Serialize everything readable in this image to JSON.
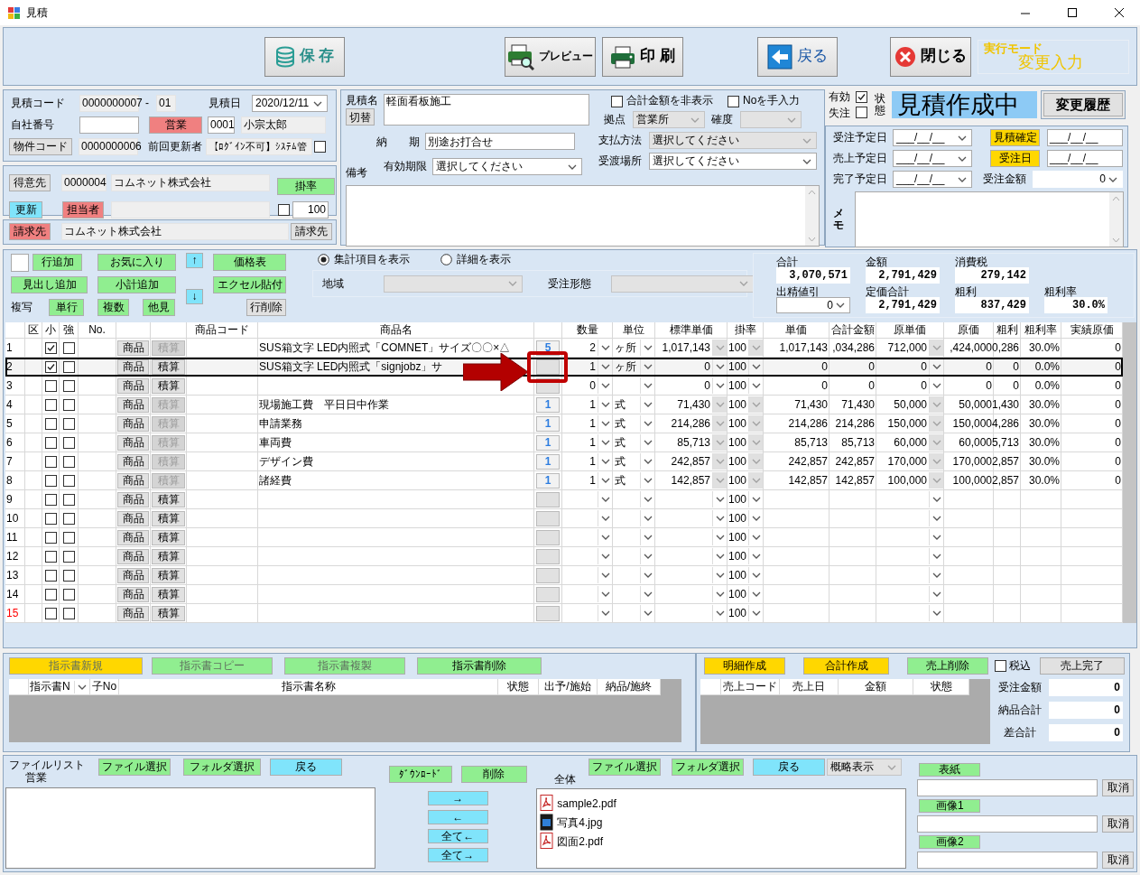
{
  "window": {
    "title": "見積"
  },
  "toolbar": {
    "buttons": [
      {
        "kind": "save",
        "label": "保 存"
      },
      {
        "kind": "preview",
        "label": "プレビュー"
      },
      {
        "kind": "print",
        "label": "印 刷"
      },
      {
        "kind": "back",
        "label": "戻る"
      },
      {
        "kind": "close",
        "label": "閉じる"
      }
    ],
    "mode_label": "実行モード",
    "mode": "変更入力"
  },
  "estimate": {
    "code_label": "見積コード",
    "code": "0000000007",
    "separator": "-",
    "branch": "01",
    "date_label": "見積日",
    "date": "2020/12/11",
    "own_number_label": "自社番号",
    "sales_button": "営業",
    "staff_code": "0001",
    "staff_name": "小宗太郎",
    "property_button": "物件コード",
    "property_code": "0000000006",
    "updater_label": "前回更新者",
    "updater": "【ﾛｸﾞｲﾝ不可】ｼｽﾃﾑ管",
    "updater_checked": false
  },
  "customer": {
    "button": "得意先",
    "code": "0000004",
    "name": "コムネット株式会社",
    "rate_button": "掛率",
    "update_button": "更新",
    "person_button": "担当者",
    "rate_checked": false,
    "rate": "100"
  },
  "billing": {
    "button": "請求先",
    "name": "コムネット株式会社",
    "select_button": "請求先"
  },
  "details": {
    "name_label": "見積名",
    "switch_button": "切替",
    "name": "軽面看板施工",
    "hide_total_label": "合計金額を非表示",
    "hide_total": false,
    "manual_no_label": "Noを手入力",
    "manual_no": false,
    "base_label": "拠点",
    "base": "営業所",
    "certainty_label": "確度",
    "delivery_label": "納　　期",
    "delivery": "別途お打合せ",
    "payment_label": "支払方法",
    "payment": "選択してください",
    "validity_label": "有効期限",
    "validity": "選択してください",
    "place_label": "受渡場所",
    "place": "選択してください",
    "notes_label": "備考"
  },
  "status": {
    "valid_label": "有効",
    "valid": true,
    "lost_label": "失注",
    "lost": false,
    "state_label": "状態",
    "state": "見積作成中",
    "history_button": "変更履歴"
  },
  "schedule": {
    "rows": [
      {
        "kind": "button",
        "label": "受注予定日",
        "date": "___/__/__",
        "button": "見積確定",
        "button_date": "___/__/__"
      },
      {
        "kind": "button",
        "label": "売上予定日",
        "date": "___/__/__",
        "button": "受注日",
        "button_date": "___/__/__"
      },
      {
        "kind": "amount",
        "label": "完了予定日",
        "date": "___/__/__",
        "amount_label": "受注金額",
        "amount": "0"
      }
    ],
    "memo_label": "メモ"
  },
  "actions": {
    "buttons": [
      {
        "label": "行追加",
        "color": "#90ee90"
      },
      {
        "label": "お気に入り",
        "color": "#90ee90"
      },
      {
        "label": "↑",
        "color": "#80e4fb"
      },
      {
        "label": "価格表",
        "color": "#90ee90"
      },
      {
        "label": "見出し追加",
        "color": "#90ee90"
      },
      {
        "label": "小計追加",
        "color": "#90ee90"
      },
      {
        "label": "↓",
        "color": "#80e4fb"
      },
      {
        "label": "エクセル貼付",
        "color": "#90ee90"
      },
      {
        "label": "単行",
        "color": "#90ee90"
      },
      {
        "label": "複数",
        "color": "#90ee90"
      },
      {
        "label": "他見",
        "color": "#90ee90"
      },
      {
        "label": "行削除",
        "color": "#e1e1e1"
      }
    ],
    "copy_label": "複写"
  },
  "display": [
    {
      "label": "集計項目を表示",
      "selected": true
    },
    {
      "label": "詳細を表示",
      "selected": false
    }
  ],
  "filters": [
    {
      "label": "地域"
    },
    {
      "label": "受注形態"
    }
  ],
  "totals": [
    {
      "label": "合計",
      "value": "3,070,571",
      "kind": "field"
    },
    {
      "label": "金額",
      "value": "2,791,429",
      "kind": "field"
    },
    {
      "label": "消費税",
      "value": "279,142",
      "kind": "field"
    },
    {
      "label": "出精値引",
      "value": "0",
      "kind": "dropdown"
    },
    {
      "label": "定価合計",
      "value": "2,791,429",
      "kind": "field"
    },
    {
      "label": "粗利",
      "value": "837,429",
      "kind": "field"
    },
    {
      "label": "粗利率",
      "value": "30.0%",
      "kind": "field"
    }
  ],
  "grid": {
    "headings": [
      "区",
      "小",
      "強",
      "No.",
      "商品コード",
      "商品名",
      "数量",
      "単位",
      "標準単価",
      "掛率",
      "単価",
      "合計金額",
      "原単価",
      "原価",
      "粗利",
      "粗利率",
      "実績原価"
    ],
    "rows": [
      {
        "no": "1",
        "highlighted": false,
        "selected": false,
        "small": true,
        "strong": false,
        "product_button": "商品",
        "calc_button": "積算",
        "locked": true,
        "name": "SUS箱文字 LED内照式「COMNET」サイズ〇〇×△",
        "count": "5",
        "cells": [
          "2",
          "ヶ所",
          "1,017,143",
          "100",
          "1,017,143",
          ",034,286",
          "712,000",
          ",424,000",
          "0,286",
          "30.0%",
          "0"
        ]
      },
      {
        "no": "2",
        "highlighted": false,
        "selected": true,
        "small": true,
        "strong": false,
        "product_button": "商品",
        "calc_button": "積算",
        "locked": false,
        "name": "SUS箱文字 LED内照式「signjobz」サ",
        "cells": [
          "1",
          "ヶ所",
          "0",
          "100",
          "0",
          "0",
          "0",
          "0",
          "0",
          "0.0%",
          "0"
        ]
      },
      {
        "no": "3",
        "highlighted": false,
        "selected": false,
        "small": false,
        "strong": false,
        "product_button": "商品",
        "calc_button": "積算",
        "locked": false,
        "cells": [
          "0",
          null,
          "0",
          "100",
          "0",
          "0",
          "0",
          "0",
          "0",
          "0.0%",
          "0"
        ]
      },
      {
        "no": "4",
        "highlighted": false,
        "selected": false,
        "small": false,
        "strong": false,
        "product_button": "商品",
        "calc_button": "積算",
        "locked": true,
        "name": "現場施工費　平日日中作業",
        "count": "1",
        "cells": [
          "1",
          "式",
          "71,430",
          "100",
          "71,430",
          "71,430",
          "50,000",
          "50,000",
          "1,430",
          "30.0%",
          "0"
        ]
      },
      {
        "no": "5",
        "highlighted": false,
        "selected": false,
        "small": false,
        "strong": false,
        "product_button": "商品",
        "calc_button": "積算",
        "locked": true,
        "name": "申請業務",
        "count": "1",
        "cells": [
          "1",
          "式",
          "214,286",
          "100",
          "214,286",
          "214,286",
          "150,000",
          "150,000",
          "4,286",
          "30.0%",
          "0"
        ]
      },
      {
        "no": "6",
        "highlighted": false,
        "selected": false,
        "small": false,
        "strong": false,
        "product_button": "商品",
        "calc_button": "積算",
        "locked": true,
        "name": "車両費",
        "count": "1",
        "cells": [
          "1",
          "式",
          "85,713",
          "100",
          "85,713",
          "85,713",
          "60,000",
          "60,000",
          "5,713",
          "30.0%",
          "0"
        ]
      },
      {
        "no": "7",
        "highlighted": false,
        "selected": false,
        "small": false,
        "strong": false,
        "product_button": "商品",
        "calc_button": "積算",
        "locked": true,
        "name": "デザイン費",
        "count": "1",
        "cells": [
          "1",
          "式",
          "242,857",
          "100",
          "242,857",
          "242,857",
          "170,000",
          "170,000",
          "2,857",
          "30.0%",
          "0"
        ]
      },
      {
        "no": "8",
        "highlighted": false,
        "selected": false,
        "small": false,
        "strong": false,
        "product_button": "商品",
        "calc_button": "積算",
        "locked": true,
        "name": "諸経費",
        "count": "1",
        "cells": [
          "1",
          "式",
          "142,857",
          "100",
          "142,857",
          "142,857",
          "100,000",
          "100,000",
          "2,857",
          "30.0%",
          "0"
        ]
      },
      {
        "no": "9",
        "highlighted": false,
        "selected": false,
        "small": false,
        "strong": false,
        "product_button": "商品",
        "calc_button": "積算",
        "locked": false,
        "cells": [
          null,
          null,
          null,
          "100",
          null,
          null,
          null,
          null,
          null,
          null,
          null
        ]
      },
      {
        "no": "10",
        "highlighted": false,
        "selected": false,
        "small": false,
        "strong": false,
        "product_button": "商品",
        "calc_button": "積算",
        "locked": false,
        "cells": [
          null,
          null,
          null,
          "100",
          null,
          null,
          null,
          null,
          null,
          null,
          null
        ]
      },
      {
        "no": "11",
        "highlighted": false,
        "selected": false,
        "small": false,
        "strong": false,
        "product_button": "商品",
        "calc_button": "積算",
        "locked": false,
        "cells": [
          null,
          null,
          null,
          "100",
          null,
          null,
          null,
          null,
          null,
          null,
          null
        ]
      },
      {
        "no": "12",
        "highlighted": false,
        "selected": false,
        "small": false,
        "strong": false,
        "product_button": "商品",
        "calc_button": "積算",
        "locked": false,
        "cells": [
          null,
          null,
          null,
          "100",
          null,
          null,
          null,
          null,
          null,
          null,
          null
        ]
      },
      {
        "no": "13",
        "highlighted": false,
        "selected": false,
        "small": false,
        "strong": false,
        "product_button": "商品",
        "calc_button": "積算",
        "locked": false,
        "cells": [
          null,
          null,
          null,
          "100",
          null,
          null,
          null,
          null,
          null,
          null,
          null
        ]
      },
      {
        "no": "14",
        "highlighted": false,
        "selected": false,
        "small": false,
        "strong": false,
        "product_button": "商品",
        "calc_button": "積算",
        "locked": false,
        "cells": [
          null,
          null,
          null,
          "100",
          null,
          null,
          null,
          null,
          null,
          null,
          null
        ]
      },
      {
        "no": "15",
        "highlighted": true,
        "selected": false,
        "small": false,
        "strong": false,
        "product_button": "商品",
        "calc_button": "積算",
        "locked": false,
        "cells": [
          null,
          null,
          null,
          "100",
          null,
          null,
          null,
          null,
          null,
          null,
          null
        ]
      }
    ]
  },
  "instructions": {
    "buttons": [
      {
        "label": "指示書新規",
        "color": "#ffd700",
        "disabled": true
      },
      {
        "label": "指示書コピー",
        "color": "#90ee90",
        "disabled": true
      },
      {
        "label": "指示書複製",
        "color": "#90ee90",
        "disabled": true
      },
      {
        "label": "指示書削除",
        "color": "#90ee90",
        "disabled": false
      }
    ],
    "columns": [
      "指示書N",
      "子No",
      "指示書名称",
      "状態",
      "出予/施始",
      "納品/施終"
    ]
  },
  "sales": {
    "buttons": [
      {
        "label": "明細作成",
        "color": "#ffd700"
      },
      {
        "label": "合計作成",
        "color": "#ffd700"
      },
      {
        "label": "売上削除",
        "color": "#90ee90"
      }
    ],
    "tax_label": "税込",
    "tax_included": false,
    "complete_button": "売上完了",
    "columns": [
      "売上コード",
      "売上日",
      "金額",
      "状態"
    ],
    "totals": [
      {
        "label": "受注金額",
        "value": "0"
      },
      {
        "label": "納品合計",
        "value": "0"
      },
      {
        "label": "差合計",
        "value": "0"
      }
    ]
  },
  "files": {
    "title": "ファイルリスト",
    "sales_label": "営業",
    "left_buttons": [
      {
        "label": "ファイル選択",
        "color": "#90ee90"
      },
      {
        "label": "フォルダ選択",
        "color": "#90ee90"
      },
      {
        "label": "戻る",
        "color": "#80e4fb"
      }
    ],
    "download_button": "ﾀﾞｳﾝﾛｰﾄﾞ",
    "delete_button": "削除",
    "move_buttons": [
      "→",
      "←",
      "全て←",
      "全て→"
    ],
    "all_label": "全体",
    "right_buttons": [
      {
        "label": "ファイル選択",
        "color": "#90ee90"
      },
      {
        "label": "フォルダ選択",
        "color": "#90ee90"
      },
      {
        "label": "戻る",
        "color": "#80e4fb"
      }
    ],
    "view": "概略表示",
    "items": [
      {
        "name": "sample2.pdf",
        "kind": "pdf"
      },
      {
        "name": "写真4.jpg",
        "kind": "image"
      },
      {
        "name": "図面2.pdf",
        "kind": "pdf"
      }
    ],
    "attachments": [
      {
        "button": "表紙",
        "cancel": "取消"
      },
      {
        "button": "画像1",
        "cancel": "取消"
      },
      {
        "button": "画像2",
        "cancel": "取消"
      }
    ]
  }
}
